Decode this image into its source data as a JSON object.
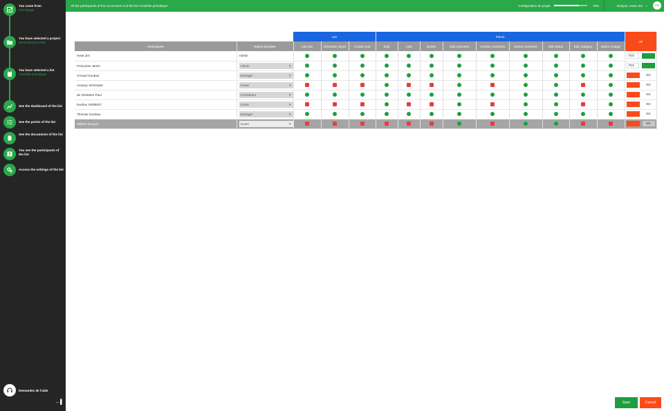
{
  "sidebar": {
    "came_from": {
      "label": "You came from",
      "sub": "Homepage"
    },
    "project": {
      "label": "You have selected a project",
      "sub": "NASHVILLE CASE"
    },
    "list": {
      "label": "You have selected a list",
      "sub": "Contrôle périodique"
    },
    "nav": [
      {
        "label": "See the dashboard of the list",
        "icon": "chart-line-icon"
      },
      {
        "label": "See the points of the list",
        "icon": "list-icon"
      },
      {
        "label": "See the documents of the list",
        "icon": "document-icon"
      },
      {
        "label": "You see the participants of the list",
        "icon": "person-badge-icon"
      },
      {
        "label": "Access the settings of the list",
        "icon": "gears-icon"
      }
    ],
    "help_label": "Demandez de l'aide",
    "collapse_icon": "←▌"
  },
  "topbar": {
    "title": "All the participants of the occurrence 8 of the list 'Contrôle périodique'",
    "config_label": "Configuration du projet",
    "progress": 75,
    "progress_text": "75%",
    "greeting": "Bonjour, Heas Jim",
    "avatar_initials": "HJ"
  },
  "table": {
    "group_list": "List",
    "group_points": "Points",
    "group_all": "All",
    "col_participants": "Participants",
    "col_template": "Rights template",
    "columns": [
      "Add doc",
      "Generate report",
      "Create next",
      "Edit",
      "Add",
      "Delete",
      "Add comment",
      "Archive comment",
      "Delete comment",
      "Edit status",
      "Edit category",
      "Edit in charge"
    ],
    "rows": [
      {
        "name": "Heas Jim",
        "template": "Admin",
        "editable": false,
        "perms": [
          1,
          1,
          1,
          1,
          1,
          1,
          1,
          1,
          1,
          1,
          1,
          1
        ],
        "all": "YES"
      },
      {
        "name": "Françoise Jamin",
        "template": "Admin",
        "editable": true,
        "perms": [
          1,
          1,
          1,
          1,
          1,
          1,
          1,
          1,
          1,
          1,
          1,
          1
        ],
        "all": "YES"
      },
      {
        "name": "Arnaud Goubau",
        "template": "Manager",
        "editable": true,
        "perms": [
          1,
          1,
          1,
          1,
          1,
          1,
          1,
          1,
          1,
          1,
          1,
          1
        ],
        "all": "NO"
      },
      {
        "name": "Amaury Verstraete",
        "template": "Guest",
        "editable": true,
        "perms": [
          0,
          0,
          0,
          1,
          0,
          0,
          1,
          0,
          1,
          1,
          0,
          1
        ],
        "all": "NO"
      },
      {
        "name": "de Gheldere Paul",
        "template": "Contributor",
        "editable": true,
        "perms": [
          1,
          1,
          1,
          1,
          1,
          1,
          1,
          1,
          1,
          1,
          1,
          1
        ],
        "all": "NO"
      },
      {
        "name": "Eveline VERBIST",
        "template": "Guest",
        "editable": true,
        "perms": [
          0,
          0,
          0,
          1,
          0,
          0,
          1,
          0,
          1,
          1,
          0,
          1
        ],
        "all": "NO"
      },
      {
        "name": "Thomas Goubau",
        "template": "Manager",
        "editable": true,
        "perms": [
          1,
          1,
          1,
          1,
          1,
          1,
          1,
          1,
          1,
          1,
          1,
          1
        ],
        "all": "NO"
      },
      {
        "name": "William Bouyon",
        "template": "Guest",
        "editable": true,
        "perms": [
          0,
          0,
          0,
          0,
          0,
          0,
          1,
          0,
          1,
          1,
          0,
          0
        ],
        "all": "NO",
        "selected": true
      }
    ]
  },
  "actions": {
    "save": "Save",
    "cancel": "Cancel"
  },
  "colors": {
    "green": "#2aa84a",
    "blue": "#1a66e0",
    "orange": "#fb4a1a",
    "sidebar": "#252525"
  }
}
